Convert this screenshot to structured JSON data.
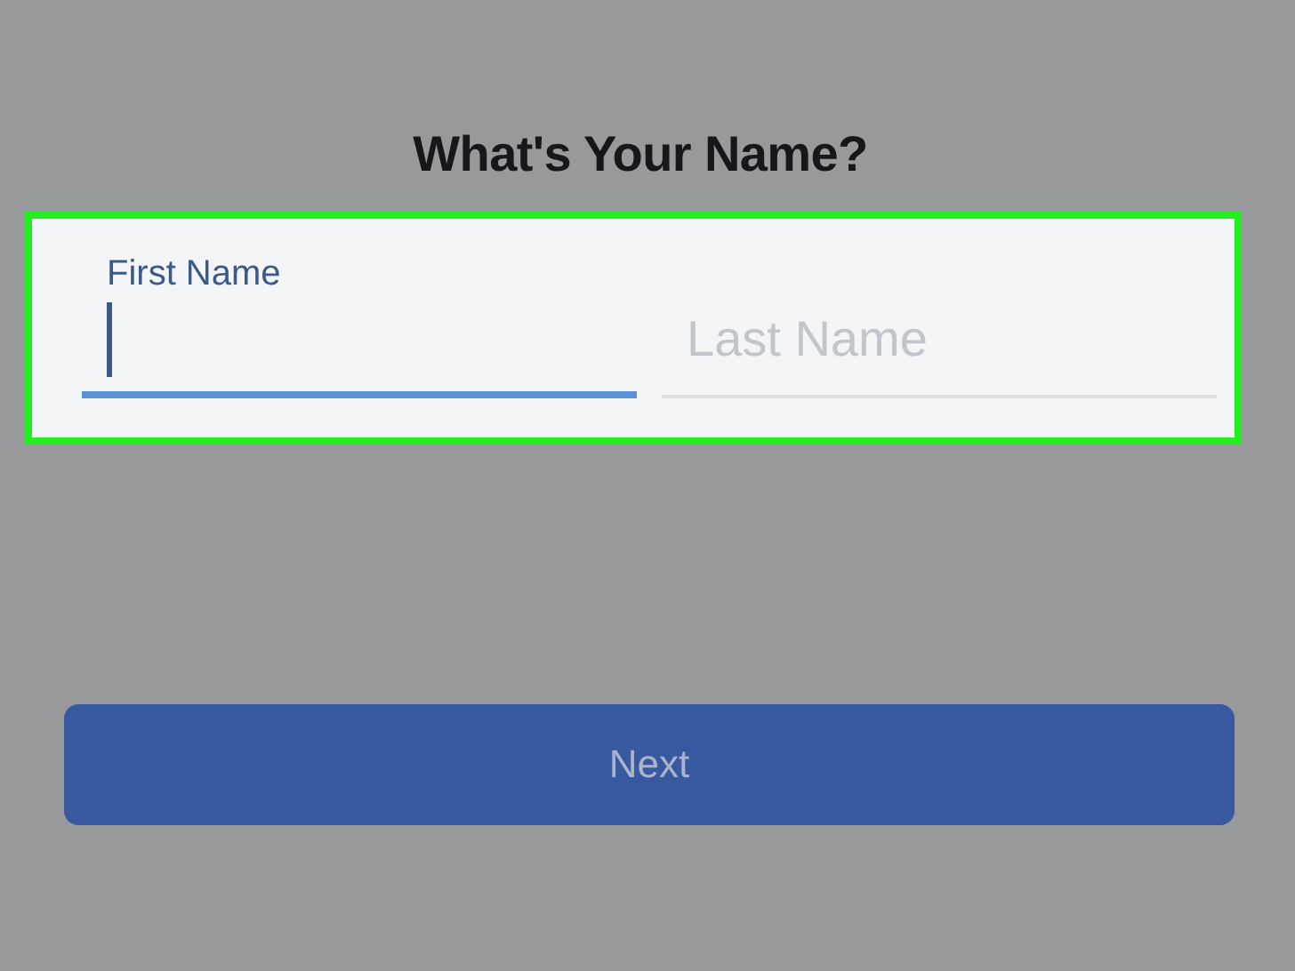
{
  "title": "What's Your Name?",
  "name_form": {
    "highlighted": true,
    "fields": [
      {
        "label": "First Name",
        "focused": true
      },
      {
        "placeholder": "Last Name",
        "focused": false
      }
    ]
  },
  "next_button": {
    "label": "Next",
    "disabled": true
  }
}
